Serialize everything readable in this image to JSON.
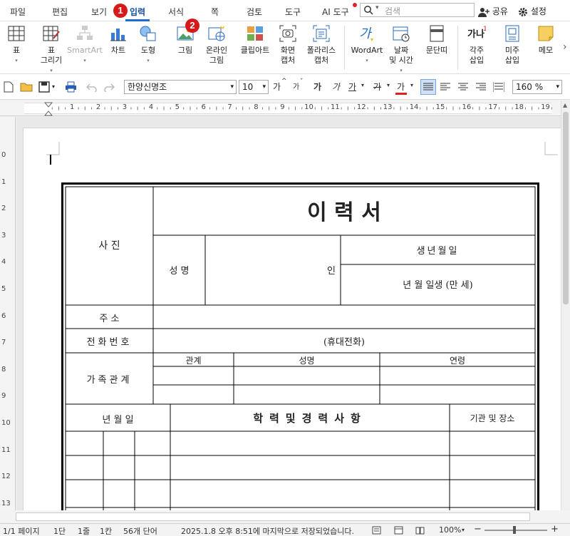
{
  "menubar": {
    "tabs": [
      "파일",
      "편집",
      "보기",
      "입력",
      "서식",
      "쪽",
      "검토",
      "도구",
      "AI 도구"
    ],
    "active_tab": "입력",
    "search_placeholder": "검색",
    "share": "공유",
    "settings": "설정",
    "step_badges": [
      "1",
      "2"
    ]
  },
  "ribbon": {
    "buttons": [
      {
        "label": "표",
        "icon": "table-icon"
      },
      {
        "label": "표\n그리기",
        "icon": "draw-table-icon"
      },
      {
        "label": "SmartArt",
        "icon": "smartart-icon",
        "disabled": true
      },
      {
        "label": "차트",
        "icon": "chart-icon"
      },
      {
        "label": "도형",
        "icon": "shapes-icon"
      },
      {
        "label": "그림",
        "icon": "picture-icon"
      },
      {
        "label": "온라인\n그림",
        "icon": "online-picture-icon"
      },
      {
        "label": "클립아트",
        "icon": "clipart-icon"
      },
      {
        "label": "화면\n캡처",
        "icon": "screen-capture-icon"
      },
      {
        "label": "폴라리스\n캡처",
        "icon": "polaris-capture-icon"
      },
      {
        "label": "WordArt",
        "icon": "wordart-icon"
      },
      {
        "label": "날짜\n및 시간",
        "icon": "date-time-icon"
      },
      {
        "label": "문단띠",
        "icon": "paragraph-band-icon"
      },
      {
        "label": "각주\n삽입",
        "icon": "footnote-icon"
      },
      {
        "label": "미주\n삽입",
        "icon": "endnote-icon"
      },
      {
        "label": "메모",
        "icon": "memo-icon"
      }
    ],
    "footnote_glyph": "가나",
    "footnote_sup": "1",
    "chevron_label": "›"
  },
  "toolbar": {
    "font": "한양신명조",
    "size": "10",
    "zoom": "160 %",
    "grow": "가",
    "shrink": "가",
    "bold": "가",
    "italic": "가",
    "under": "가",
    "strike": "가",
    "color": "가",
    "font_caret": "▾",
    "size_caret": "▾",
    "zoom_caret": "▾",
    "arrow_up": "^",
    "arrow_dn": "ˇ"
  },
  "ruler": {
    "h": [
      "1",
      "2",
      "3",
      "4",
      "5",
      "6",
      "7",
      "8",
      "9",
      "10",
      "11",
      "12",
      "13",
      "14",
      "15",
      "16",
      "17",
      "18",
      "19"
    ],
    "v": [
      "0",
      "1",
      "2",
      "3",
      "4",
      "5",
      "6",
      "7",
      "8",
      "9",
      "10",
      "11",
      "12",
      "13"
    ]
  },
  "doc": {
    "title": "이   력   서",
    "photo": "사 진",
    "name": "성   명",
    "seal": "인",
    "birth": "생년월일",
    "birth_line": "년   월   일생 (만    세)",
    "address": "주        소",
    "phone": "전화번호",
    "mobile": "(휴대전화)",
    "family": "가족관계",
    "fam_headers": [
      "관계",
      "성명",
      "연령"
    ],
    "ymd": "년    월    일",
    "history": "학력및경력사항",
    "org": "기관 및 장소"
  },
  "status": {
    "page": "1/1 페이지",
    "section": "1단",
    "line": "1줄",
    "col": "1칸",
    "words": "56개 단어",
    "saved": "2025.1.8 오후 8:51에 마지막으로 저장되었습니다.",
    "zoom": "100%"
  }
}
